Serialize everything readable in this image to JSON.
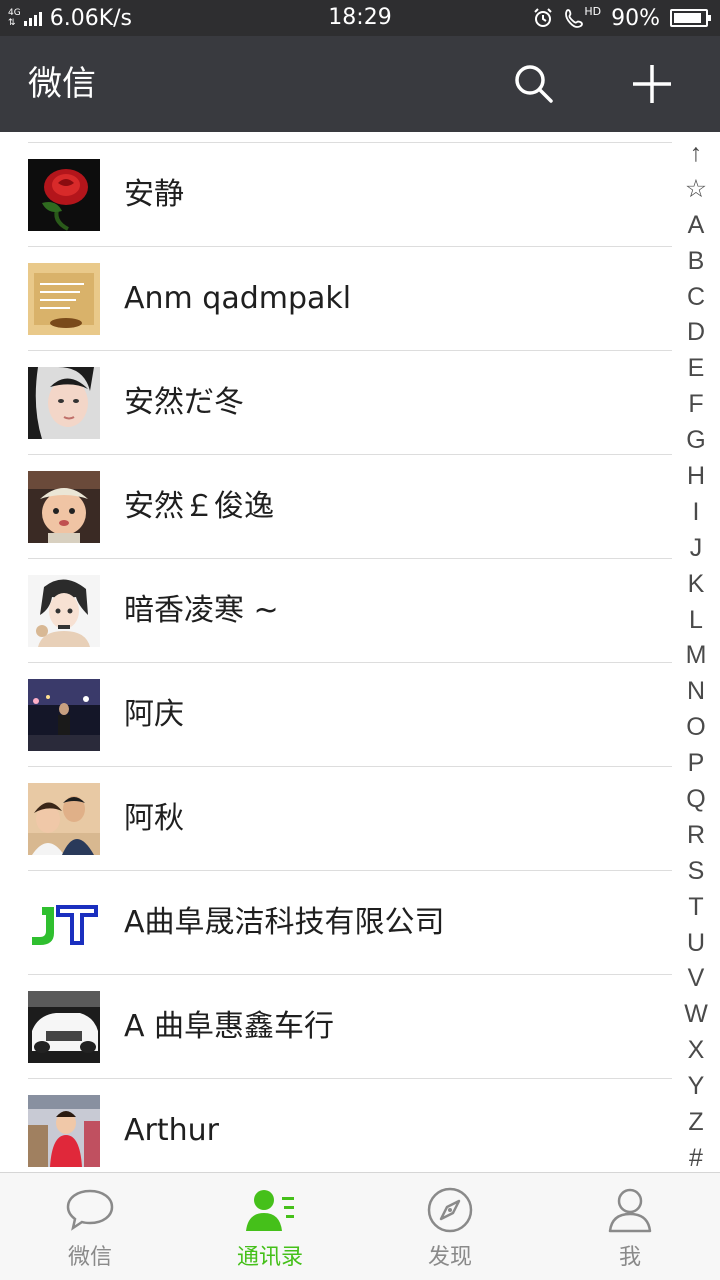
{
  "status_bar": {
    "network_top": "4G",
    "network_top2": "4G",
    "speed": "6.06K/s",
    "time": "18:29",
    "hd": "HD",
    "battery": "90%",
    "battery_level": 0.9
  },
  "header": {
    "title": "微信",
    "search_icon": "search-icon",
    "add_icon": "plus-icon"
  },
  "contacts": [
    {
      "name": "安静"
    },
    {
      "name": "Anm qadmpakl"
    },
    {
      "name": "安然だ冬"
    },
    {
      "name": "安然￡俊逸"
    },
    {
      "name": "暗香凌寒 ~"
    },
    {
      "name": "阿庆"
    },
    {
      "name": "阿秋"
    },
    {
      "name": "A曲阜晟洁科技有限公司"
    },
    {
      "name": "A 曲阜惠鑫车行"
    },
    {
      "name": "Arthur"
    }
  ],
  "index_letters": [
    "↑",
    "☆",
    "A",
    "B",
    "C",
    "D",
    "E",
    "F",
    "G",
    "H",
    "I",
    "J",
    "K",
    "L",
    "M",
    "N",
    "O",
    "P",
    "Q",
    "R",
    "S",
    "T",
    "U",
    "V",
    "W",
    "X",
    "Y",
    "Z",
    "#"
  ],
  "tabs": [
    {
      "label": "微信",
      "icon": "chat-bubble-icon",
      "active": false
    },
    {
      "label": "通讯录",
      "icon": "contacts-icon",
      "active": true
    },
    {
      "label": "发现",
      "icon": "compass-icon",
      "active": false
    },
    {
      "label": "我",
      "icon": "person-icon",
      "active": false
    }
  ],
  "colors": {
    "header_bg": "#393a3f",
    "status_bg": "#2e2e30",
    "accent": "#45c01a"
  }
}
